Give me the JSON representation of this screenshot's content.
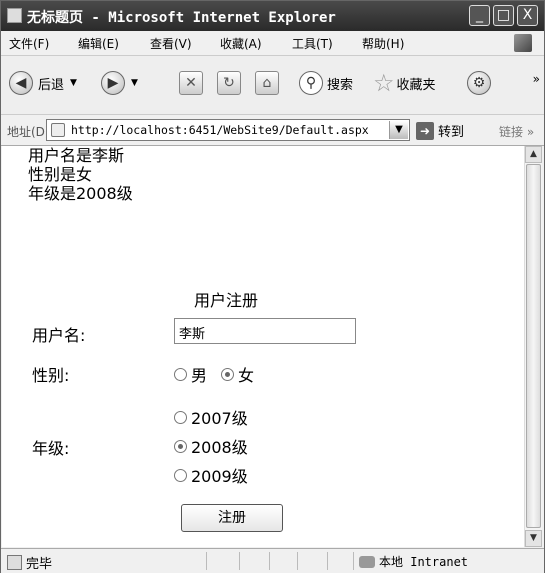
{
  "window": {
    "title": "无标题页 - Microsoft Internet Explorer",
    "minimize": "_",
    "maximize": "□",
    "close": "X"
  },
  "menu": [
    "文件(F)",
    "编辑(E)",
    "查看(V)",
    "收藏(A)",
    "工具(T)",
    "帮助(H)"
  ],
  "toolbar": {
    "back_label": "后退",
    "search_label": "搜索",
    "favorites_label": "收藏夹",
    "more": "»"
  },
  "address": {
    "label": "地址(D)",
    "url": "http://localhost:6451/WebSite9/Default.aspx",
    "go_label": "转到",
    "links_label": "链接",
    "more": "»"
  },
  "page": {
    "info_lines": [
      "用户名是李斯",
      "性别是女",
      "年级是2008级"
    ],
    "form_title": "用户注册",
    "username_label": "用户名:",
    "username_value": "李斯",
    "gender_label": "性别:",
    "gender_options": [
      {
        "label": "男",
        "checked": false
      },
      {
        "label": "女",
        "checked": true
      }
    ],
    "grade_label": "年级:",
    "grade_options": [
      {
        "label": "2007级",
        "checked": false
      },
      {
        "label": "2008级",
        "checked": true
      },
      {
        "label": "2009级",
        "checked": false
      }
    ],
    "submit_label": "注册"
  },
  "status": {
    "text": "完毕",
    "zone": "本地 Intranet"
  }
}
